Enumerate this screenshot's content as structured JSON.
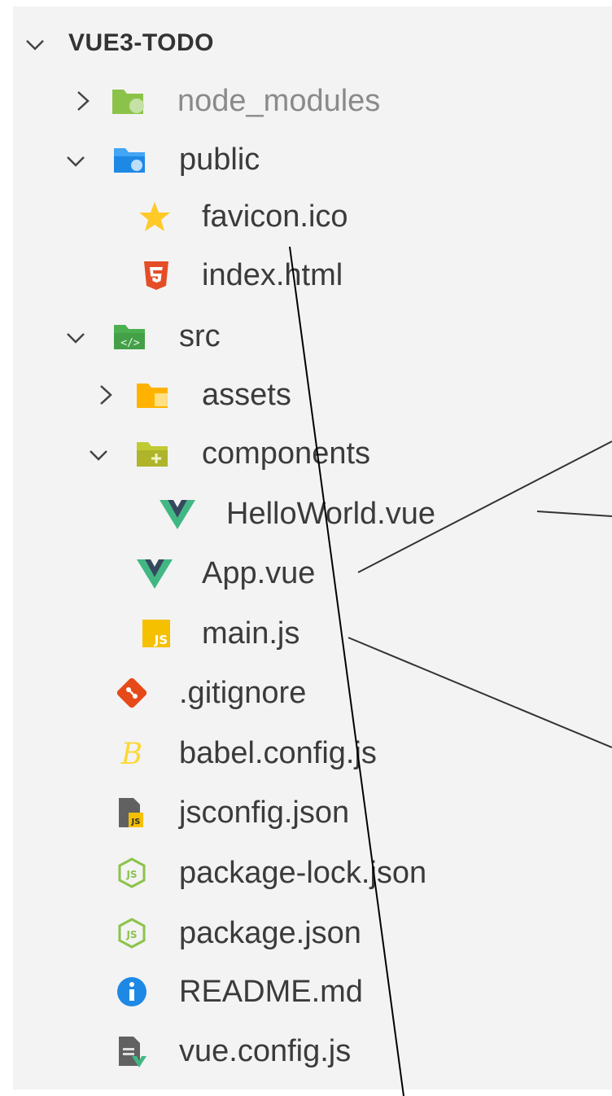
{
  "explorer": {
    "root": {
      "label": "VUE3-TODO",
      "expanded": true
    },
    "items": [
      {
        "label": "node_modules",
        "icon": "node-folder-icon",
        "expanded": false,
        "muted": true
      },
      {
        "label": "public",
        "icon": "public-folder-icon",
        "expanded": true
      },
      {
        "label": "favicon.ico",
        "icon": "star-icon"
      },
      {
        "label": "index.html",
        "icon": "html5-icon"
      },
      {
        "label": "src",
        "icon": "src-folder-icon",
        "expanded": true
      },
      {
        "label": "assets",
        "icon": "assets-folder-icon",
        "expanded": false
      },
      {
        "label": "components",
        "icon": "components-folder-icon",
        "expanded": true
      },
      {
        "label": "HelloWorld.vue",
        "icon": "vue-icon"
      },
      {
        "label": "App.vue",
        "icon": "vue-icon"
      },
      {
        "label": "main.js",
        "icon": "js-icon"
      },
      {
        "label": ".gitignore",
        "icon": "git-icon"
      },
      {
        "label": "babel.config.js",
        "icon": "babel-icon"
      },
      {
        "label": "jsconfig.json",
        "icon": "jsconfig-icon"
      },
      {
        "label": "package-lock.json",
        "icon": "nodejs-icon"
      },
      {
        "label": "package.json",
        "icon": "nodejs-icon"
      },
      {
        "label": "README.md",
        "icon": "info-icon"
      },
      {
        "label": "vue.config.js",
        "icon": "vue-config-icon"
      }
    ]
  },
  "colors": {
    "panel_bg": "#f3f3f3",
    "text": "#3b3b3b",
    "muted_text": "#8a8a8a",
    "vue_green": "#41b883",
    "vue_dark": "#35495e",
    "html_red": "#e44d26",
    "js_yellow": "#f5c000",
    "info_blue": "#1e88e5"
  }
}
